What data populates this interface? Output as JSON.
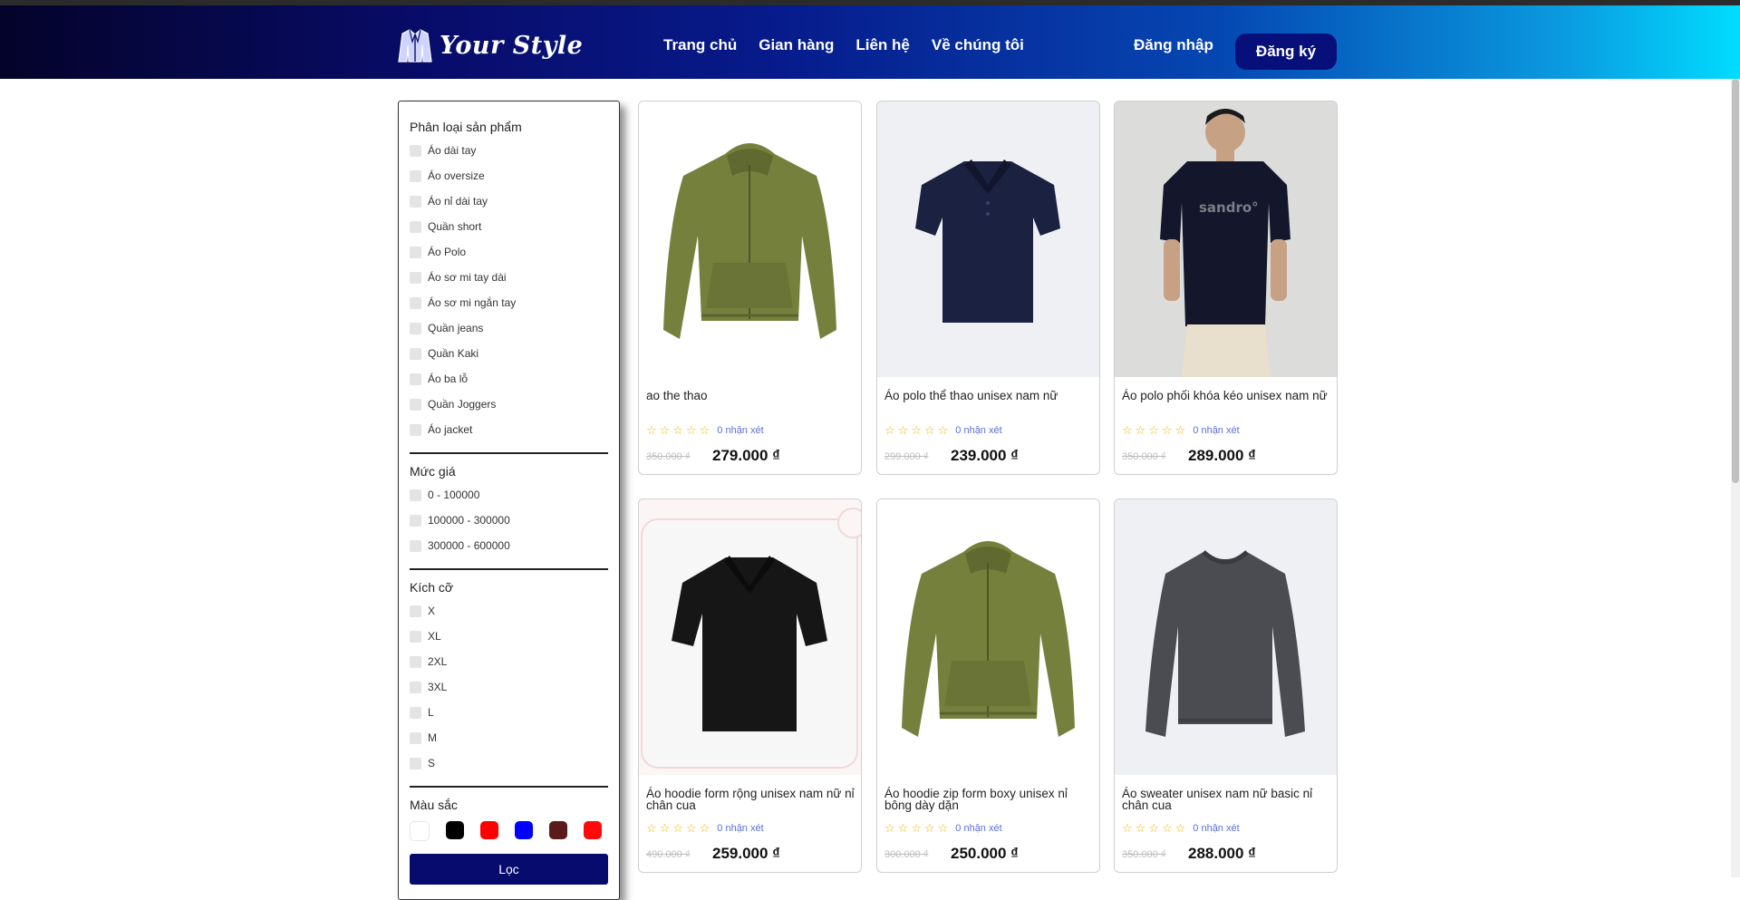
{
  "brand": {
    "name": "Your Style"
  },
  "nav": [
    {
      "label": "Trang chủ"
    },
    {
      "label": "Gian hàng"
    },
    {
      "label": "Liên hệ"
    },
    {
      "label": "Về chúng tôi"
    }
  ],
  "auth": {
    "login": "Đăng nhập",
    "signup": "Đăng ký"
  },
  "filters": {
    "category": {
      "title": "Phân loại sản phẩm",
      "options": [
        "Áo dài tay",
        "Áo oversize",
        "Áo nỉ dài tay",
        "Quần short",
        "Áo Polo",
        "Áo sơ mi tay dài",
        "Áo sơ mi ngắn tay",
        "Quần jeans",
        "Quần Kaki",
        "Áo ba lỗ",
        "Quần Joggers",
        "Áo jacket"
      ]
    },
    "price": {
      "title": "Mức giá",
      "options": [
        "0 - 100000",
        "100000 - 300000",
        "300000 - 600000"
      ]
    },
    "size": {
      "title": "Kích cỡ",
      "options": [
        "X",
        "XL",
        "2XL",
        "3XL",
        "L",
        "M",
        "S"
      ]
    },
    "color": {
      "title": "Màu sắc",
      "swatches": [
        "#ffffff",
        "#000000",
        "#ff0000",
        "#0000ff",
        "#5c1a1a",
        "#ff0a0a"
      ]
    },
    "submit": "Lọc"
  },
  "products": [
    {
      "name": "ao the thao",
      "reviews": "0 nhận xét",
      "old_price": "350.000 ₫",
      "price": "279.000 ₫",
      "image": "olive-hoodie"
    },
    {
      "name": "Áo polo thể thao unisex nam nữ",
      "reviews": "0 nhận xét",
      "old_price": "299.000 ₫",
      "price": "239.000 ₫",
      "image": "navy-polo"
    },
    {
      "name": "Áo polo phối khóa kéo unisex nam nữ",
      "reviews": "0 nhận xét",
      "old_price": "350.000 ₫",
      "price": "289.000 ₫",
      "image": "model-black-tee",
      "print": "sandro"
    },
    {
      "name": "Áo hoodie form rộng unisex nam nữ nỉ chân cua",
      "reviews": "0 nhận xét",
      "old_price": "490.000 ₫",
      "price": "259.000 ₫",
      "image": "black-polo"
    },
    {
      "name": "Áo hoodie zip form boxy unisex nỉ bông dày dặn",
      "reviews": "0 nhận xét",
      "old_price": "300.000 ₫",
      "price": "250.000 ₫",
      "image": "olive-hoodie"
    },
    {
      "name": "Áo sweater unisex nam nữ basic nỉ chân cua",
      "reviews": "0 nhận xét",
      "old_price": "350.000 ₫",
      "price": "288.000 ₫",
      "image": "grey-sweater"
    }
  ]
}
